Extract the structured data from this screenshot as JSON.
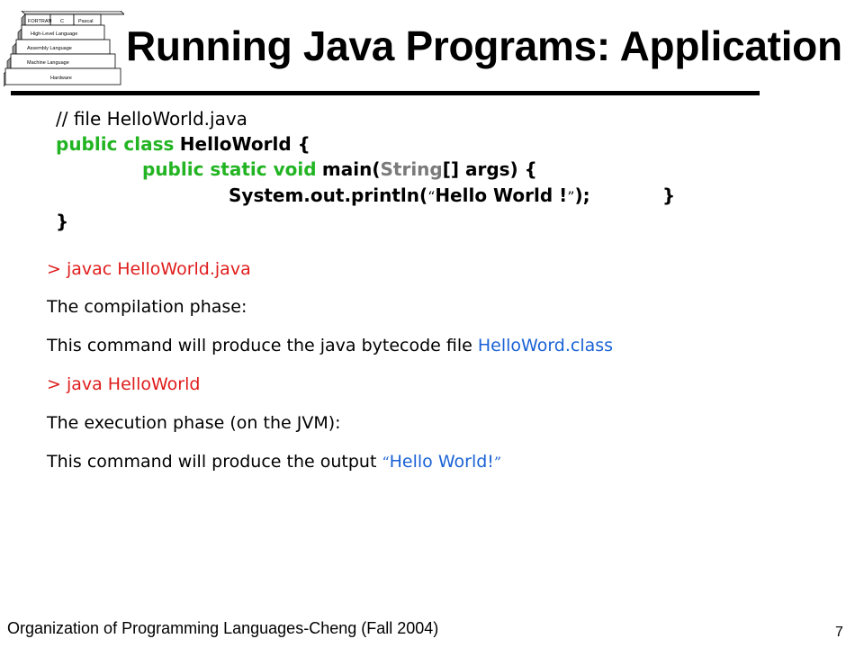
{
  "logo": {
    "top_blocks": [
      "FORTRAN",
      "C",
      "Pascal"
    ],
    "layers": [
      "High-Level Language",
      "Assembly Language",
      "Machine Language",
      "Hardware"
    ]
  },
  "title": "Running Java Programs: Application",
  "code": {
    "comment": "// file HelloWorld.java",
    "l2_kw": "public class",
    "l2_name": "HelloWorld {",
    "l3_kw": "public static void",
    "l3_main": "main(",
    "l3_string": "String",
    "l3_rest": "[] args) {",
    "l4_call": "System.out.println(",
    "l4_open_quote": "“",
    "l4_text": "Hello World !",
    "l4_close_quote": "”",
    "l4_end": ");",
    "l4_brace": "}",
    "l5_brace": "}"
  },
  "lines": {
    "cmd1": "> javac HelloWorld.java",
    "compile_phase": "The compilation phase:",
    "compile_desc": "This command will produce the java bytecode file ",
    "compile_file": "HelloWord.class",
    "cmd2": "> java HelloWorld",
    "exec_phase": "The execution phase (on the JVM):",
    "exec_desc": "This command will produce the output ",
    "exec_open_quote": "“",
    "exec_output": "Hello World!",
    "exec_close_quote": "”"
  },
  "footer": "Organization of Programming Languages-Cheng (Fall 2004)",
  "page_number": "7"
}
